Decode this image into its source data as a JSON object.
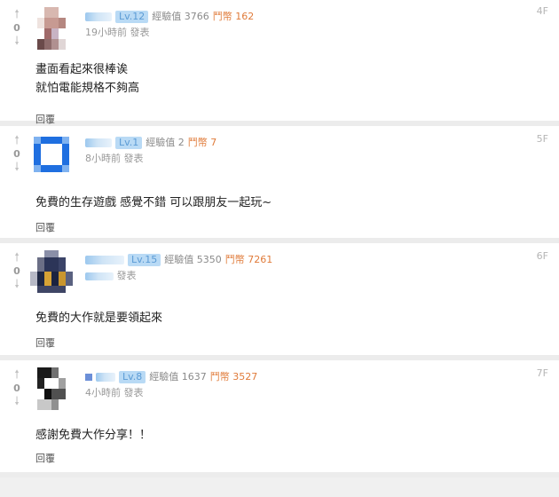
{
  "comments": [
    {
      "floor": "4F",
      "score": "0",
      "level": "Lv.12",
      "exp": "經驗值 3766",
      "gp": "鬥幣 162",
      "time": "19小時前 發表",
      "lines": [
        "畫面看起來很棒诶",
        "就怕電能規格不夠高"
      ],
      "reply": "回覆"
    },
    {
      "floor": "5F",
      "score": "0",
      "level": "Lv.1",
      "exp": "經驗值 2",
      "gp": "鬥幣 7",
      "time": "8小時前 發表",
      "lines": [
        "免費的生存遊戲 感覺不錯 可以跟朋友一起玩~"
      ],
      "reply": "回覆"
    },
    {
      "floor": "6F",
      "score": "0",
      "level": "Lv.15",
      "exp": "經驗值 5350",
      "gp": "鬥幣 7261",
      "time": "發表",
      "lines": [
        "免費的大作就是要領起來"
      ],
      "reply": "回覆"
    },
    {
      "floor": "7F",
      "score": "0",
      "level": "Lv.8",
      "exp": "經驗值 1637",
      "gp": "鬥幣 3527",
      "time": "4小時前 發表",
      "lines": [
        "感謝免費大作分享！！"
      ],
      "reply": "回覆"
    }
  ],
  "icons": {
    "up": "arrow-up-icon",
    "down": "arrow-down-icon"
  },
  "colors": {
    "level_badge": "#b9daf5",
    "gp": "#e07b3a"
  }
}
